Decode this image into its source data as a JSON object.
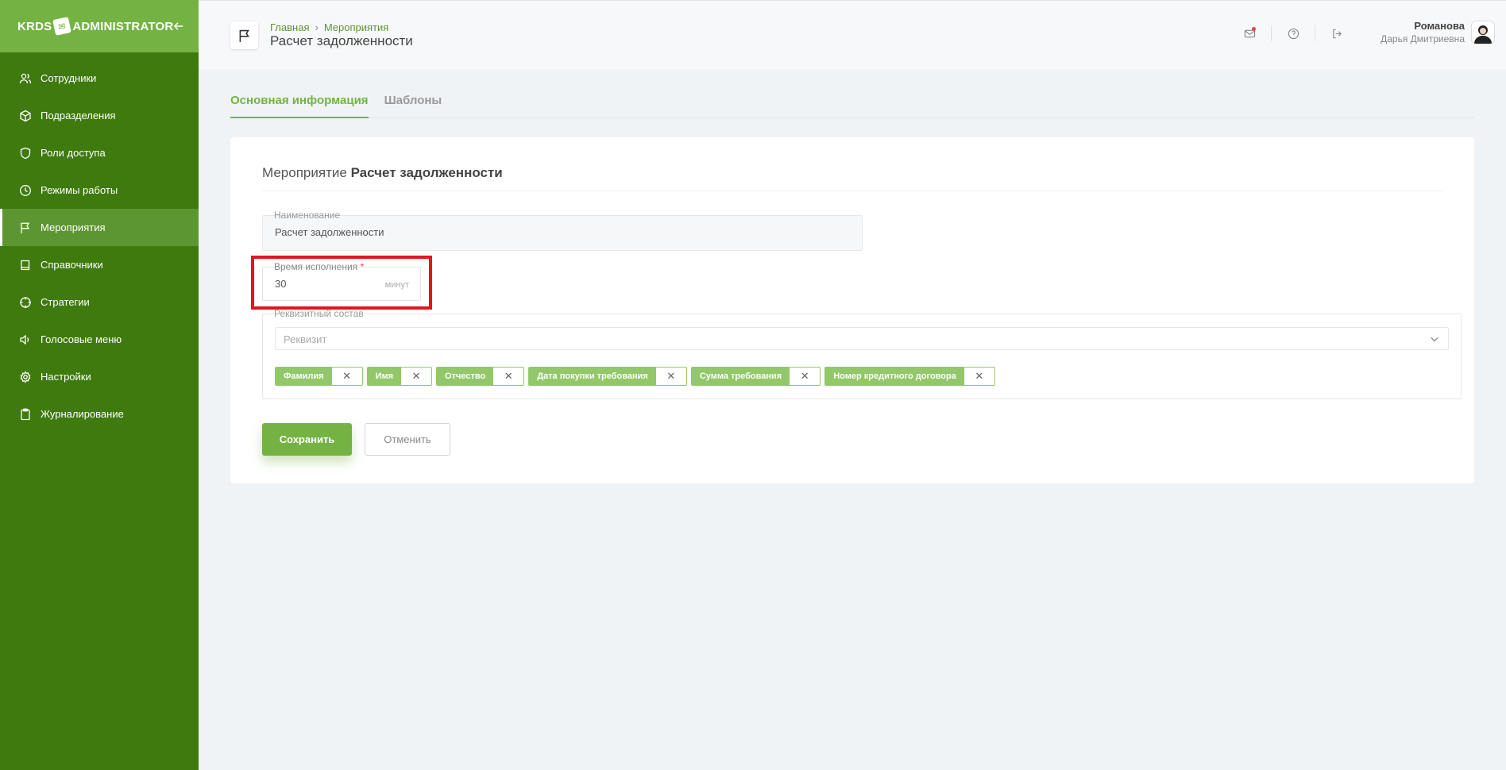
{
  "sidebar": {
    "logo_left": "KRDS",
    "logo_mark": "✉",
    "logo_right": "ADMINISTRATOR",
    "items": [
      {
        "label": "Сотрудники",
        "icon": "users-icon"
      },
      {
        "label": "Подразделения",
        "icon": "cube-icon"
      },
      {
        "label": "Роли доступа",
        "icon": "shield-icon"
      },
      {
        "label": "Режимы работы",
        "icon": "clock-icon"
      },
      {
        "label": "Мероприятия",
        "icon": "flag-icon",
        "active": true
      },
      {
        "label": "Справочники",
        "icon": "book-icon"
      },
      {
        "label": "Стратегии",
        "icon": "target-icon"
      },
      {
        "label": "Голосовые меню",
        "icon": "speaker-icon"
      },
      {
        "label": "Настройки",
        "icon": "gear-icon"
      },
      {
        "label": "Журналирование",
        "icon": "clipboard-icon"
      }
    ]
  },
  "header": {
    "breadcrumb": [
      "Главная",
      "Мероприятия"
    ],
    "title": "Расчет задолженности",
    "user_last_name": "Романова",
    "user_first_name": "Дарья Дмитриевна"
  },
  "tabs": [
    {
      "label": "Основная информация",
      "active": true
    },
    {
      "label": "Шаблоны",
      "active": false
    }
  ],
  "form": {
    "title_prefix": "Мероприятие",
    "title_name": "Расчет задолженности",
    "name_label": "Наименование",
    "name_value": "Расчет задолженности",
    "time_label": "Время исполнения",
    "time_required": "*",
    "time_value": "30",
    "time_unit": "минут",
    "rekv_label": "Реквизитный состав",
    "rekv_placeholder": "Реквизит",
    "tags": [
      "Фамилия",
      "Имя",
      "Отчество",
      "Дата покупки требования",
      "Сумма требования",
      "Номер кредитного договора"
    ],
    "save_label": "Сохранить",
    "cancel_label": "Отменить"
  },
  "colors": {
    "sidebar_bg": "#3e7a0e",
    "sidebar_top": "#74b343",
    "accent": "#74b343",
    "highlight": "#e0171d"
  }
}
